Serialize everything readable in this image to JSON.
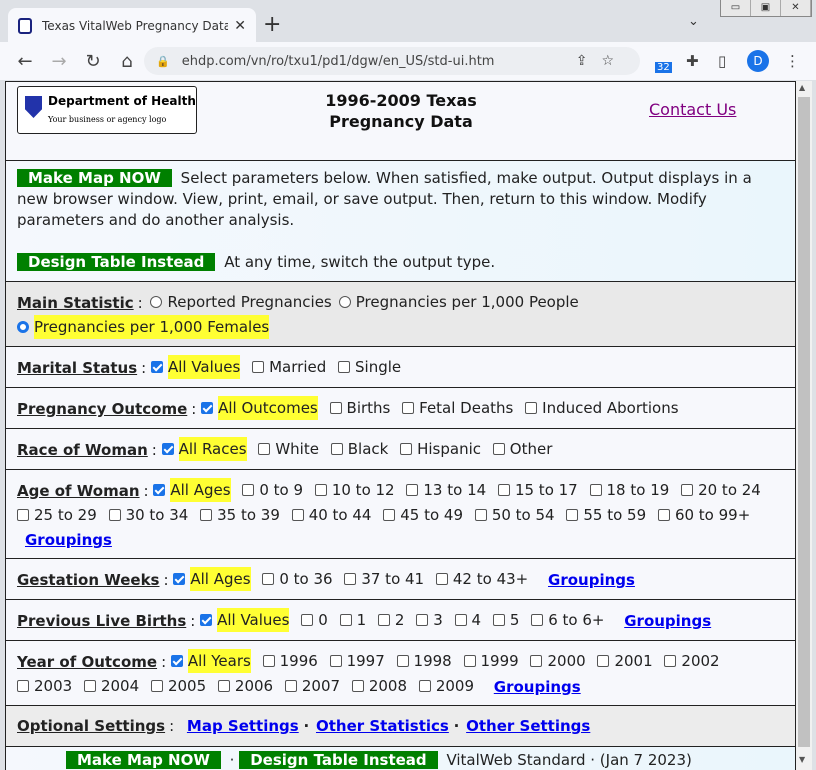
{
  "browser": {
    "tab_title": "Texas VitalWeb Pregnancy Data -",
    "url": "ehdp.com/vn/ro/txu1/pd1/dgw/en_US/std-ui.htm",
    "ext_badge": "32",
    "avatar": "D"
  },
  "header": {
    "logo_title": "Department of Health",
    "logo_sub": "Your business or agency logo",
    "title_line1": "1996-2009 Texas",
    "title_line2": "Pregnancy Data",
    "contact": "Contact Us"
  },
  "intro": {
    "make_map": "Make Map NOW",
    "text1": "Select parameters below. When satisfied, make output. Output displays in a new browser window. View, print, email, or save output. Then, return to this window. Modify parameters and do another analysis.",
    "design_table": "Design Table Instead",
    "text2": "At any time, switch the output type."
  },
  "main_statistic": {
    "label": "Main Statistic",
    "options": [
      {
        "label": "Reported Pregnancies",
        "selected": false
      },
      {
        "label": "Pregnancies per 1,000 People",
        "selected": false
      },
      {
        "label": "Pregnancies per 1,000 Females",
        "selected": true
      }
    ]
  },
  "sections": [
    {
      "key": "marital",
      "label": "Marital Status",
      "options": [
        {
          "label": "All Values",
          "checked": true
        },
        {
          "label": "Married",
          "checked": false
        },
        {
          "label": "Single",
          "checked": false
        }
      ]
    },
    {
      "key": "outcome",
      "label": "Pregnancy Outcome",
      "options": [
        {
          "label": "All Outcomes",
          "checked": true
        },
        {
          "label": "Births",
          "checked": false
        },
        {
          "label": "Fetal Deaths",
          "checked": false
        },
        {
          "label": "Induced Abortions",
          "checked": false
        }
      ]
    },
    {
      "key": "race",
      "label": "Race of Woman",
      "options": [
        {
          "label": "All Races",
          "checked": true
        },
        {
          "label": "White",
          "checked": false
        },
        {
          "label": "Black",
          "checked": false
        },
        {
          "label": "Hispanic",
          "checked": false
        },
        {
          "label": "Other",
          "checked": false
        }
      ]
    },
    {
      "key": "age",
      "label": "Age of Woman",
      "options": [
        {
          "label": "All Ages",
          "checked": true
        },
        {
          "label": "0 to 9"
        },
        {
          "label": "10 to 12"
        },
        {
          "label": "13 to 14"
        },
        {
          "label": "15 to 17"
        },
        {
          "label": "18 to 19"
        },
        {
          "label": "20 to 24"
        },
        {
          "label": "25 to 29"
        },
        {
          "label": "30 to 34"
        },
        {
          "label": "35 to 39"
        },
        {
          "label": "40 to 44"
        },
        {
          "label": "45 to 49"
        },
        {
          "label": "50 to 54"
        },
        {
          "label": "55 to 59"
        },
        {
          "label": "60 to 99+"
        }
      ],
      "link": "Groupings"
    },
    {
      "key": "gestation",
      "label": "Gestation Weeks",
      "options": [
        {
          "label": "All Ages",
          "checked": true
        },
        {
          "label": "0 to 36"
        },
        {
          "label": "37 to 41"
        },
        {
          "label": "42 to 43+"
        }
      ],
      "link": "Groupings"
    },
    {
      "key": "prev",
      "label": "Previous Live Births",
      "options": [
        {
          "label": "All Values",
          "checked": true
        },
        {
          "label": "0"
        },
        {
          "label": "1"
        },
        {
          "label": "2"
        },
        {
          "label": "3"
        },
        {
          "label": "4"
        },
        {
          "label": "5"
        },
        {
          "label": "6 to 6+"
        }
      ],
      "link": "Groupings"
    },
    {
      "key": "year",
      "label": "Year of Outcome",
      "options": [
        {
          "label": "All Years",
          "checked": true
        },
        {
          "label": "1996"
        },
        {
          "label": "1997"
        },
        {
          "label": "1998"
        },
        {
          "label": "1999"
        },
        {
          "label": "2000"
        },
        {
          "label": "2001"
        },
        {
          "label": "2002"
        },
        {
          "label": "2003"
        },
        {
          "label": "2004"
        },
        {
          "label": "2005"
        },
        {
          "label": "2006"
        },
        {
          "label": "2007"
        },
        {
          "label": "2008"
        },
        {
          "label": "2009"
        }
      ],
      "link": "Groupings"
    }
  ],
  "optional": {
    "label": "Optional Settings",
    "links": [
      "Map Settings",
      "Other Statistics",
      "Other Settings"
    ],
    "sep": "·"
  },
  "footer": {
    "make_map": "Make Map NOW",
    "sep": "·",
    "design_table": "Design Table Instead",
    "text": "VitalWeb Standard · (Jan 7 2023)"
  },
  "colors": {
    "button_green": "#008000",
    "highlight": "#ffff33",
    "link": "#0000ee",
    "visited": "#800080"
  }
}
